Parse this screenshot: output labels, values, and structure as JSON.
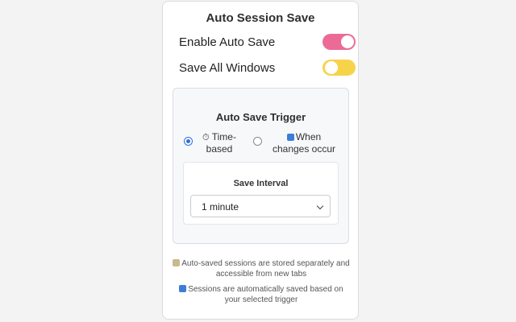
{
  "header": {
    "title": "Auto Session Save"
  },
  "settings": {
    "enable_auto_save": {
      "label": "Enable Auto Save",
      "on": true,
      "color": "#ec6b96"
    },
    "save_all_windows": {
      "label": "Save All Windows",
      "on": false,
      "color": "#f7d34a"
    }
  },
  "trigger": {
    "title": "Auto Save Trigger",
    "options": [
      {
        "icon": "stopwatch-icon",
        "glyph": "⏱",
        "label_line1": "Time-",
        "label_line2": "based",
        "selected": true
      },
      {
        "icon": "refresh-icon",
        "glyph": "🔄",
        "label_line1": "When",
        "label_line2": "changes occur",
        "selected": false
      }
    ]
  },
  "interval": {
    "title": "Save Interval",
    "selected": "1 minute"
  },
  "info": {
    "line1": "Auto-saved sessions are stored separately and",
    "line1b": "accessible from new tabs",
    "line2": "Sessions are automatically saved based on",
    "line2b": "your selected trigger",
    "line1_icon": "memo-icon",
    "line2_icon": "refresh-icon"
  },
  "colors": {
    "accent_pink": "#ec6b96",
    "accent_yellow": "#f7d34a",
    "radio_blue": "#2f6fde"
  }
}
